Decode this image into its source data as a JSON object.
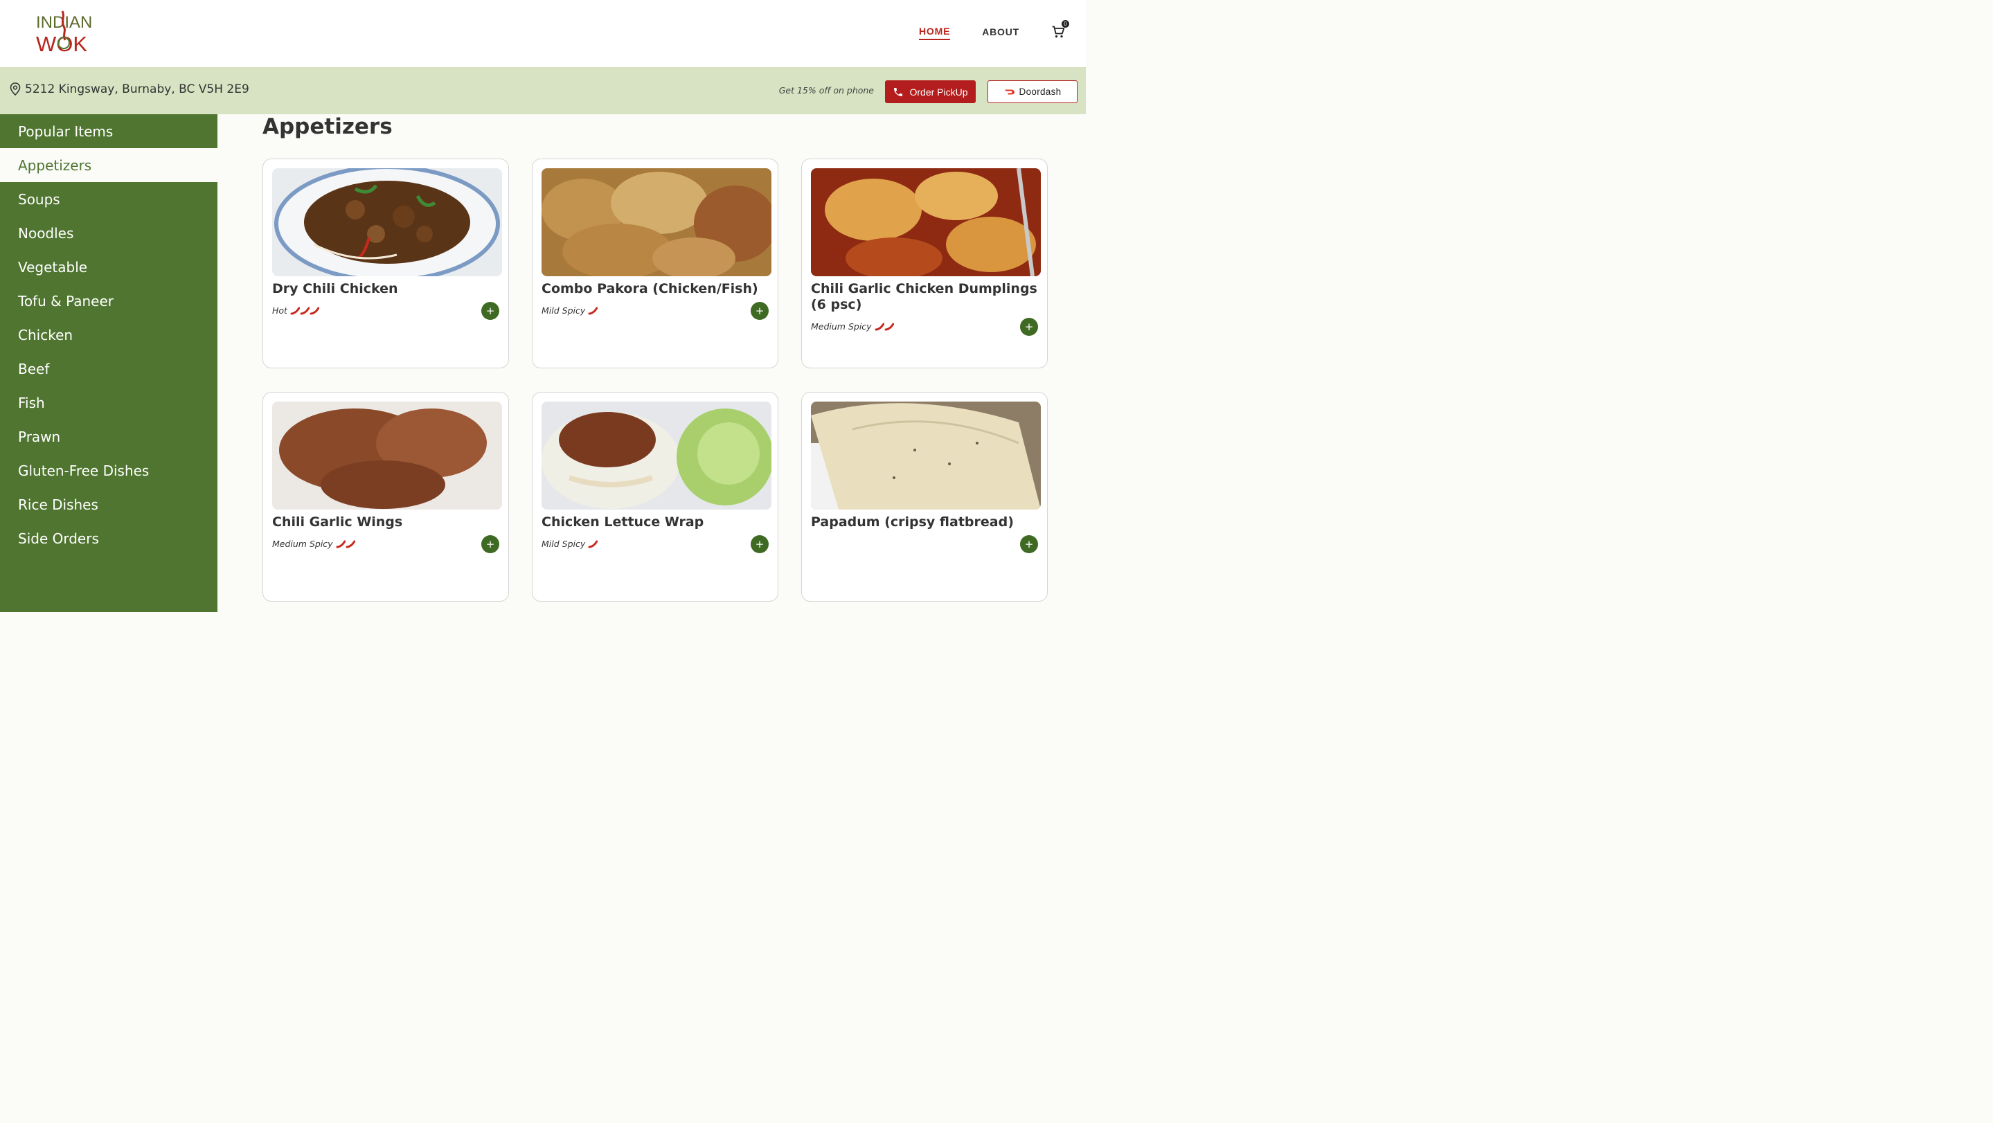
{
  "brand": {
    "logo_top": "INDIAN",
    "logo_bottom": "WOK"
  },
  "nav": {
    "home": "HOME",
    "about": "ABOUT",
    "cart_count": "0",
    "cart_icon": "cart-icon"
  },
  "infobar": {
    "address": "5212 Kingsway, Burnaby, BC V5H 2E9",
    "promo": "Get 15% off on phone",
    "pickup_label": "Order PickUp",
    "doordash_label": "Doordash"
  },
  "sidebar": {
    "items": [
      {
        "label": "Popular Items"
      },
      {
        "label": "Appetizers",
        "selected": true
      },
      {
        "label": "Soups"
      },
      {
        "label": "Noodles"
      },
      {
        "label": "Vegetable"
      },
      {
        "label": "Tofu & Paneer"
      },
      {
        "label": "Chicken"
      },
      {
        "label": "Beef"
      },
      {
        "label": "Fish"
      },
      {
        "label": "Prawn"
      },
      {
        "label": "Gluten-Free Dishes"
      },
      {
        "label": "Rice Dishes"
      },
      {
        "label": "Side Orders"
      }
    ]
  },
  "main": {
    "title": "Appetizers",
    "items": [
      {
        "name": "Dry Chili Chicken",
        "spice_label": "Hot",
        "chilies": 3,
        "add": "+"
      },
      {
        "name": "Combo Pakora (Chicken/Fish)",
        "spice_label": "Mild Spicy",
        "chilies": 1,
        "add": "+"
      },
      {
        "name": "Chili Garlic Chicken Dumplings (6 psc)",
        "spice_label": "Medium Spicy",
        "chilies": 2,
        "add": "+"
      },
      {
        "name": "Chili Garlic Wings",
        "spice_label": "Medium Spicy",
        "chilies": 2,
        "add": "+"
      },
      {
        "name": "Chicken Lettuce Wrap",
        "spice_label": "Mild Spicy",
        "chilies": 1,
        "add": "+"
      },
      {
        "name": "Papadum (cripsy flatbread)",
        "spice_label": "",
        "chilies": 0,
        "add": "+"
      }
    ]
  },
  "colors": {
    "brand_green": "#4f7530",
    "brand_red": "#b41d1d",
    "infobar_bg": "#d7e3c2"
  }
}
